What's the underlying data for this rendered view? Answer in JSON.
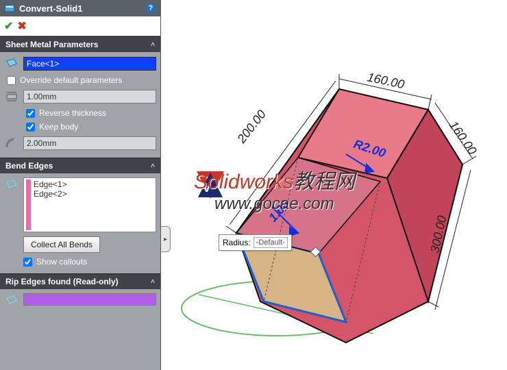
{
  "header": {
    "title": "Convert-Solid1"
  },
  "sections": {
    "sheetMetal": {
      "title": "Sheet Metal Parameters",
      "face": "Face<1>",
      "overrideLabel": "Override default parameters",
      "overrideChecked": false,
      "thickness": "1.00mm",
      "reverseLabel": "Reverse thickness",
      "reverseChecked": true,
      "keepBodyLabel": "Keep body",
      "keepBodyChecked": true,
      "bendRadius": "2.00mm"
    },
    "bendEdges": {
      "title": "Bend Edges",
      "items": [
        "Edge<1>",
        "Edge<2>"
      ],
      "collectLabel": "Collect All Bends",
      "showCalloutsLabel": "Show callouts",
      "showCalloutsChecked": true
    },
    "ripEdges": {
      "title": "Rip Edges found (Read-only)"
    }
  },
  "callout": {
    "label": "Radius:",
    "value": "-Default-"
  },
  "dimensions": {
    "d160a": "160.00",
    "d160b": "160.00",
    "d200": "200.00",
    "d300": "300.00",
    "r200": "R2.00",
    "t100": "1.00"
  },
  "watermark": {
    "line1a": "Solidworks",
    "line1b": "教程网",
    "line2": "www.gocae.com"
  }
}
